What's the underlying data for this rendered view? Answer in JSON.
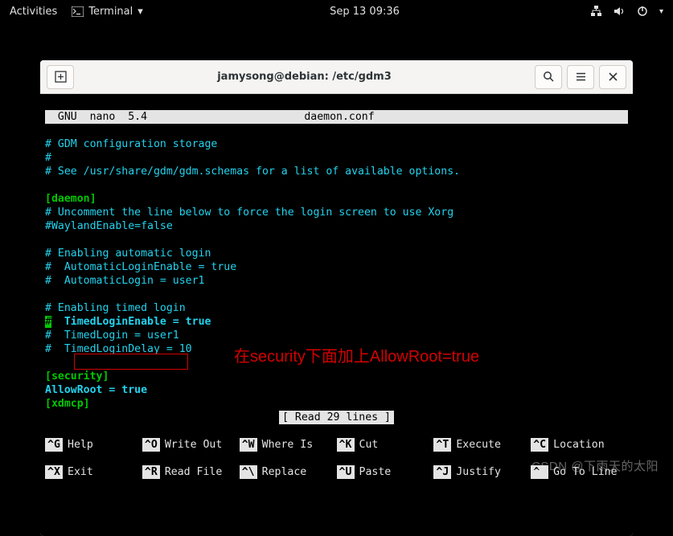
{
  "topbar": {
    "activities": "Activities",
    "app": "Terminal",
    "clock": "Sep 13  09:36"
  },
  "window": {
    "title": "jamysong@debian: /etc/gdm3"
  },
  "nano": {
    "name": "GNU  nano  5.4",
    "file": "daemon.conf",
    "status": "[ Read 29 lines ]",
    "body": {
      "l1": "# GDM configuration storage",
      "l2": "#",
      "l3": "# See /usr/share/gdm/gdm.schemas for a list of available options.",
      "l5": "[daemon]",
      "l6": "# Uncomment the line below to force the login screen to use Xorg",
      "l7": "#WaylandEnable=false",
      "l9": "# Enabling automatic login",
      "l10": "#  AutomaticLoginEnable = true",
      "l11": "#  AutomaticLogin = user1",
      "l13": "# Enabling timed login",
      "l14a": "#",
      "l14b": "  TimedLoginEnable = true",
      "l15": "#  TimedLogin = user1",
      "l16": "#  TimedLoginDelay = 10",
      "l18": "[security]",
      "l19": "AllowRoot = true",
      "l20": "[xdmcp]"
    },
    "shortcuts": {
      "g": "Help",
      "o": "Write Out",
      "w": "Where Is",
      "k": "Cut",
      "t": "Execute",
      "c": "Location",
      "x": "Exit",
      "r": "Read File",
      "bs": "Replace",
      "u": "Paste",
      "j": "Justify",
      "sl": "Go To Line"
    },
    "keys": {
      "g": "^G",
      "o": "^O",
      "w": "^W",
      "k": "^K",
      "t": "^T",
      "c": "^C",
      "x": "^X",
      "r": "^R",
      "bs": "^\\",
      "u": "^U",
      "j": "^J",
      "sl": "^ "
    }
  },
  "annotation": "在security下面加上AllowRoot=true",
  "watermark": "CSDN @下雨天的太阳"
}
